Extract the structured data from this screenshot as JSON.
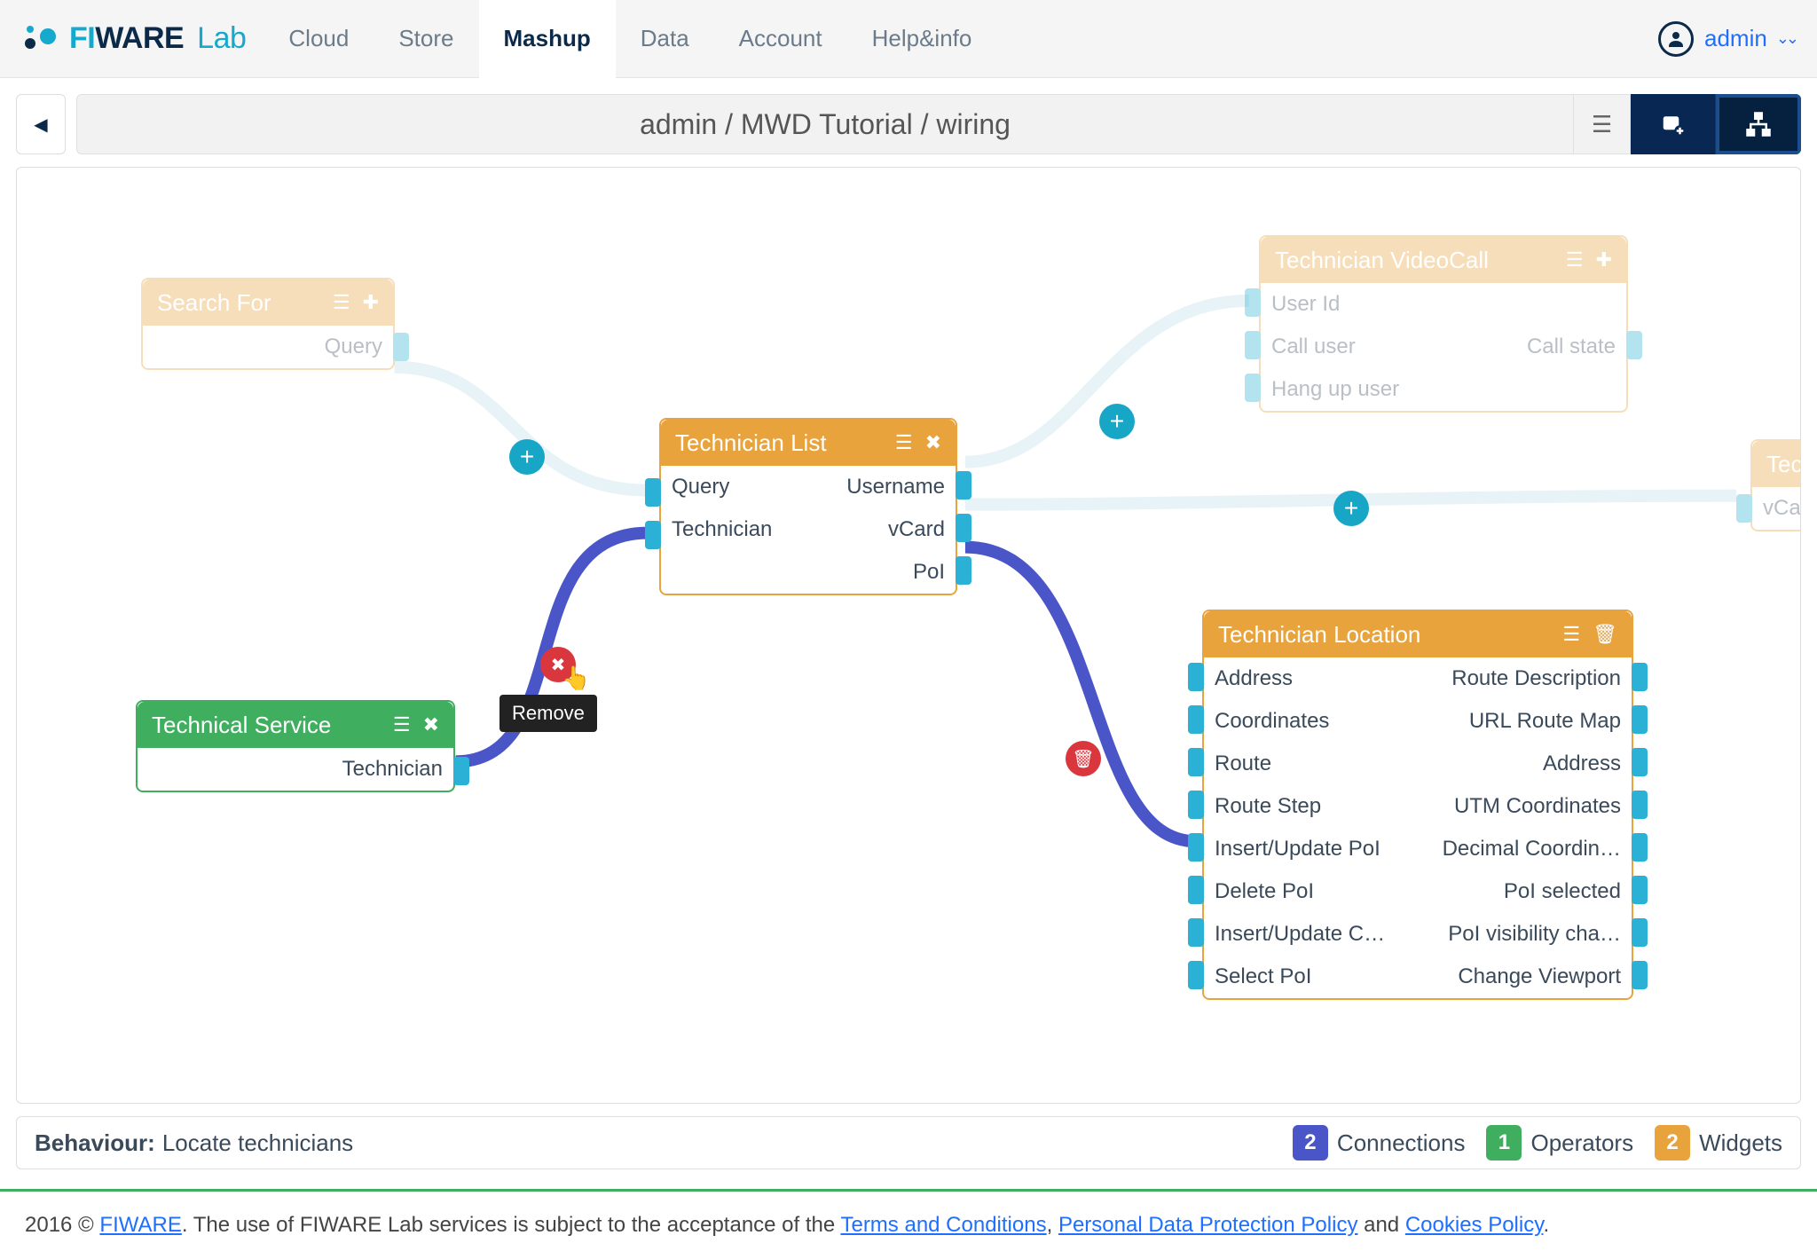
{
  "nav": {
    "links": [
      "Cloud",
      "Store",
      "Mashup",
      "Data",
      "Account",
      "Help&info"
    ],
    "active": "Mashup",
    "user": "admin"
  },
  "toolbar": {
    "title": "admin / MWD Tutorial / wiring"
  },
  "tooltip": {
    "remove": "Remove"
  },
  "nodes": {
    "searchFor": {
      "title": "Search For",
      "outputs": [
        "Query"
      ]
    },
    "technicianList": {
      "title": "Technician List",
      "inputs": [
        "Query",
        "Technician"
      ],
      "outputs": [
        "Username",
        "vCard",
        "PoI"
      ]
    },
    "technicalService": {
      "title": "Technical Service",
      "outputs": [
        "Technician"
      ]
    },
    "technicianVideoCall": {
      "title": "Technician VideoCall",
      "inputs": [
        "User Id",
        "Call user",
        "Hang up user"
      ],
      "outputs": [
        "",
        "Call state",
        ""
      ]
    },
    "techPartial": {
      "title": "Tech",
      "inputs": [
        "vCard"
      ]
    },
    "technicianLocation": {
      "title": "Technician Location",
      "inputs": [
        "Address",
        "Coordinates",
        "Route",
        "Route Step",
        "Insert/Update PoI",
        "Delete PoI",
        "Insert/Update C…",
        "Select PoI"
      ],
      "outputs": [
        "Route Description",
        "URL Route Map",
        "Address",
        "UTM Coordinates",
        "Decimal Coordin…",
        "PoI selected",
        "PoI visibility cha…",
        "Change Viewport"
      ]
    }
  },
  "footer": {
    "behaviourLabel": "Behaviour:",
    "behaviourValue": "Locate technicians",
    "connections": {
      "count": "2",
      "label": "Connections"
    },
    "operators": {
      "count": "1",
      "label": "Operators"
    },
    "widgets": {
      "count": "2",
      "label": "Widgets"
    }
  },
  "pageFooter": {
    "prefix": "2016 © ",
    "fiware": "FIWARE",
    "mid": ". The use of FIWARE Lab services is subject to the acceptance of the ",
    "terms": "Terms and Conditions",
    "sep1": ", ",
    "privacy": "Personal Data Protection Policy",
    "sep2": " and ",
    "cookies": "Cookies Policy",
    "end": "."
  }
}
